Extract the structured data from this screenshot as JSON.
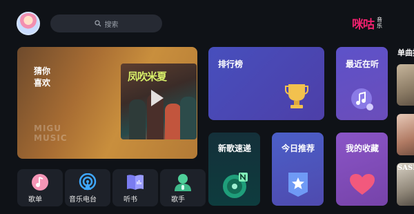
{
  "header": {
    "search_placeholder": "搜索",
    "brand_name": "咪咕",
    "brand_sub_1": "音",
    "brand_sub_2": "乐"
  },
  "featured": {
    "title_line1": "猜你",
    "title_line2": "喜欢",
    "watermark_line1": "MIGU",
    "watermark_line2": "MUSIC",
    "album_title": "凤吹米夏"
  },
  "cards": {
    "ranking": "排行榜",
    "recent": "最近在听",
    "new_songs": "新歌速递",
    "daily": "今日推荐",
    "favorites": "我的收藏"
  },
  "shortcuts": {
    "songlist": "歌单",
    "radio": "音乐电台",
    "audiobook": "听书",
    "singer": "歌手"
  },
  "right_column": {
    "title": "单曲推",
    "thumb_text": "SASHA"
  },
  "colors": {
    "brand": "#f0206e",
    "background": "#0f1217"
  },
  "icons": [
    "search-icon",
    "trophy-icon",
    "music-note-icon",
    "vinyl-icon",
    "star-badge-icon",
    "heart-icon",
    "songlist-icon",
    "radio-icon",
    "book-icon",
    "singer-icon",
    "play-icon"
  ]
}
